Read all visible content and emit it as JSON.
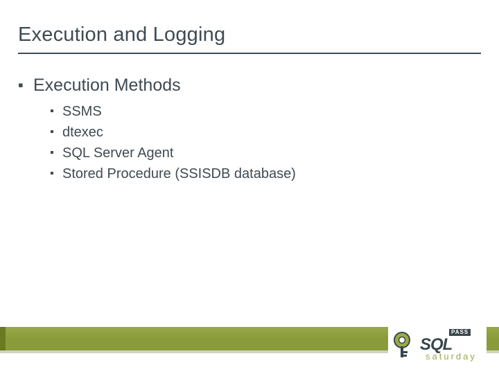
{
  "title": "Execution and Logging",
  "bullets": [
    {
      "text": "Execution Methods",
      "children": [
        {
          "text": "SSMS"
        },
        {
          "text": "dtexec"
        },
        {
          "text": "SQL Server Agent"
        },
        {
          "text": "Stored Procedure (SSISDB database)"
        }
      ]
    }
  ],
  "logo": {
    "badge": "PASS",
    "main": "SQL",
    "sub": "saturday"
  },
  "colors": {
    "text": "#3e4a52",
    "accent": "#8a9b3c",
    "accent_dark": "#6b7a22"
  }
}
